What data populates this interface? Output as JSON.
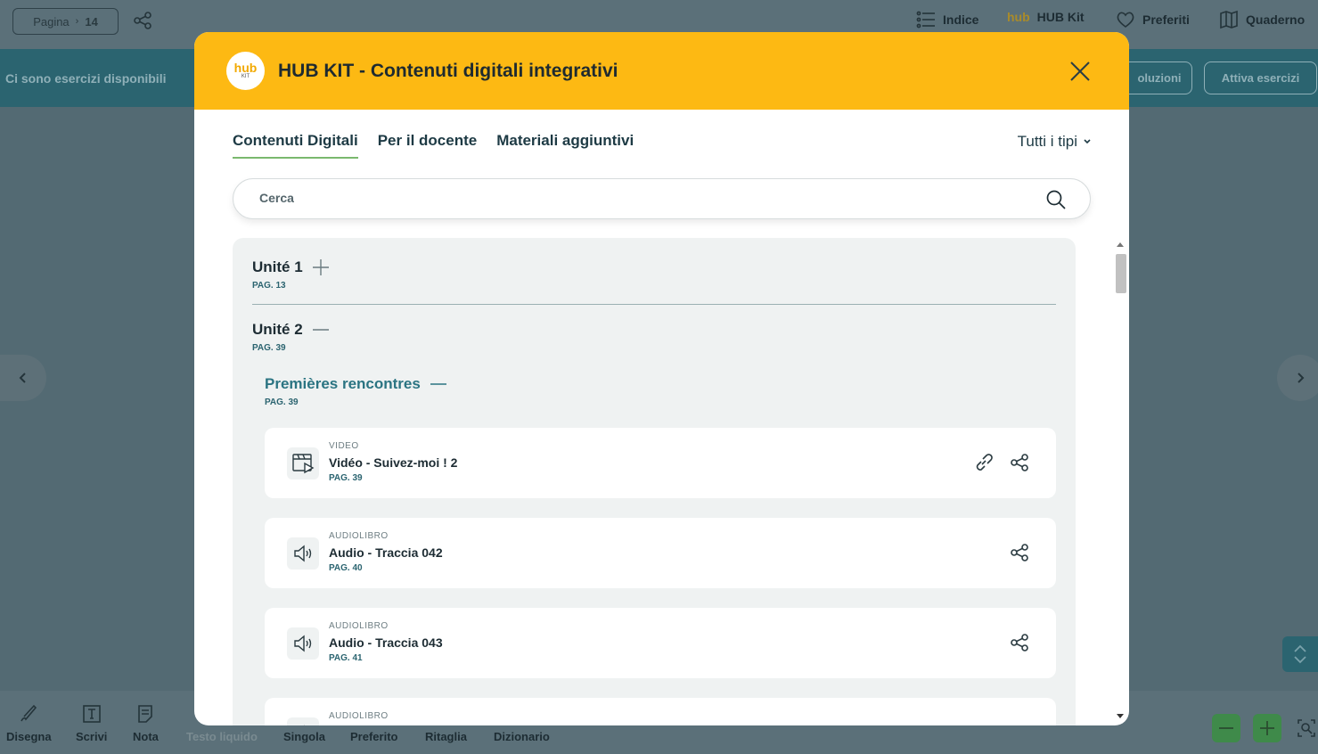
{
  "topbar": {
    "page_label": "Pagina",
    "page_number": "14",
    "items": [
      {
        "label": "Indice",
        "icon": "list-icon"
      },
      {
        "label": "HUB Kit",
        "icon": "hub-kit-icon"
      },
      {
        "label": "Preferiti",
        "icon": "heart-icon"
      },
      {
        "label": "Quaderno",
        "icon": "book-icon"
      }
    ]
  },
  "banner": {
    "text": "Ci sono esercizi disponibili",
    "solutions_button": "oluzioni",
    "activate_button": "Attiva esercizi"
  },
  "bottombar": {
    "tools": [
      {
        "label": "Disegna",
        "icon": "pen-icon"
      },
      {
        "label": "Scrivi",
        "icon": "text-icon"
      },
      {
        "label": "Nota",
        "icon": "note-icon"
      },
      {
        "label": "Testo liquido",
        "icon": ""
      },
      {
        "label": "Singola",
        "icon": ""
      },
      {
        "label": "Preferito",
        "icon": ""
      },
      {
        "label": "Ritaglia",
        "icon": ""
      },
      {
        "label": "Dizionario",
        "icon": ""
      }
    ]
  },
  "modal": {
    "logo_hub": "hub",
    "logo_kit": "KIT",
    "title": "HUB KIT - Contenuti digitali integrativi",
    "tabs": [
      {
        "label": "Contenuti Digitali",
        "active": true
      },
      {
        "label": "Per il docente",
        "active": false
      },
      {
        "label": "Materiali aggiuntivi",
        "active": false
      }
    ],
    "filter_label": "Tutti i tipi",
    "search_placeholder": "Cerca",
    "units": [
      {
        "title": "Unité 1",
        "page": "PAG. 13",
        "expanded": false
      },
      {
        "title": "Unité 2",
        "page": "PAG. 39",
        "expanded": true
      }
    ],
    "section": {
      "title": "Premières rencontres",
      "page": "PAG. 39"
    },
    "items": [
      {
        "type": "VIDEO",
        "title": "Vidéo - Suivez-moi ! 2",
        "page": "PAG. 39",
        "icon": "video-icon",
        "has_link": true
      },
      {
        "type": "AUDIOLIBRO",
        "title": "Audio - Traccia 042",
        "page": "PAG. 40",
        "icon": "speaker-icon",
        "has_link": false
      },
      {
        "type": "AUDIOLIBRO",
        "title": "Audio - Traccia 043",
        "page": "PAG. 41",
        "icon": "speaker-icon",
        "has_link": false
      },
      {
        "type": "AUDIOLIBRO",
        "title": "",
        "page": "",
        "icon": "speaker-icon",
        "has_link": false
      }
    ]
  },
  "colors": {
    "modal_header": "#fdb913",
    "accent_teal": "#2b6470",
    "tab_underline": "#7ab86e",
    "zoom_button": "#3f8a4a"
  }
}
